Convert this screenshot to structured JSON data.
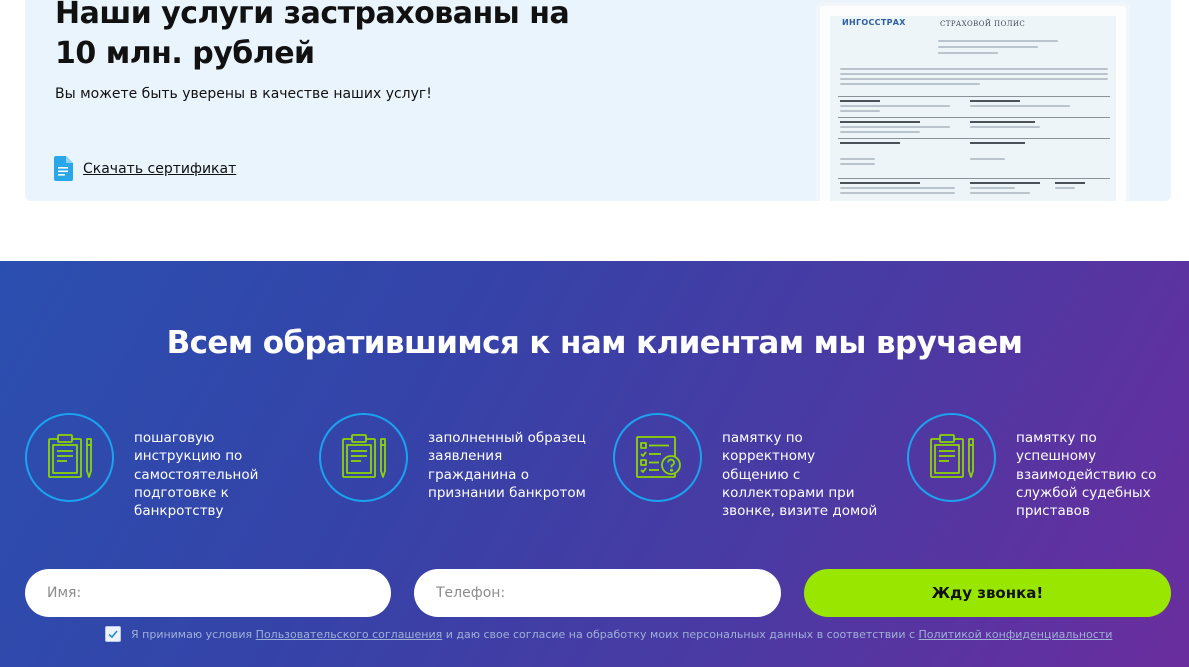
{
  "insurance": {
    "title": "Наши услуги застрахованы на 10 млн. рублей",
    "subtitle": "Вы можете быть уверены в качестве наших услуг!",
    "download_label": "Скачать сертификат",
    "certificate": {
      "brand": "ИНГОССТРАХ",
      "title": "СТРАХОВОЙ ПОЛИС"
    }
  },
  "promo": {
    "title": "Всем обратившимся к нам клиентам мы вручаем",
    "features": [
      {
        "icon": "clipboard-pencil-icon",
        "text": "пошаговую инструкцию по самостоятельной подготовке к банкротству"
      },
      {
        "icon": "clipboard-pencil-icon",
        "text": "заполненный образец заявления гражданина о признании банкротом"
      },
      {
        "icon": "checklist-question-icon",
        "text": "памятку по корректному общению с коллекторами при звонке, визите домой"
      },
      {
        "icon": "clipboard-pencil-icon",
        "text": "памятку по успешному взаимодействию со службой судебных приставов"
      }
    ],
    "form": {
      "name_placeholder": "Имя:",
      "phone_placeholder": "Телефон:",
      "submit_label": "Жду звонка!"
    },
    "consent": {
      "text_1": "Я принимаю условия",
      "link_1": "Пользовательского соглашения",
      "text_2": "и даю свое согласие на обработку моих персональных данных в соответствии с",
      "link_2": "Политикой конфиденциальности",
      "checked": true
    }
  },
  "colors": {
    "card_bg": "#eaf4fd",
    "gradient_start": "#2b4fb0",
    "gradient_end": "#6a2d9e",
    "icon_ring": "#1aa3ee",
    "icon_green": "#8dd500",
    "cta": "#99e600"
  }
}
